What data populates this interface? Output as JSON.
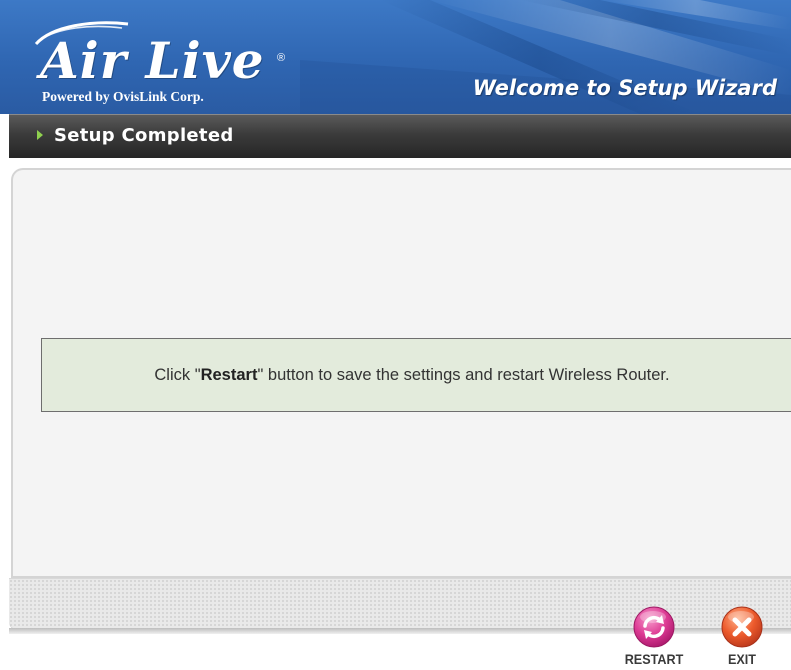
{
  "header": {
    "brand": "Air Live",
    "brand_reg": "®",
    "tagline": "Powered by OvisLink Corp.",
    "title": "Welcome to Setup Wizard",
    "colors": {
      "banner": "#2f66b2",
      "text": "#ffffff"
    }
  },
  "section": {
    "title": "Setup Completed",
    "arrow_icon": "triangle-right-icon",
    "arrow_color": "#8fd14f"
  },
  "message": {
    "prefix": "Click \"",
    "bold": "Restart",
    "suffix": "\" button to save the settings and restart Wireless Router."
  },
  "buttons": {
    "restart": {
      "label": "RESTART",
      "icon": "refresh-icon",
      "color": "#d6358a"
    },
    "exit": {
      "label": "EXIT",
      "icon": "close-icon",
      "color": "#e8542a"
    }
  }
}
